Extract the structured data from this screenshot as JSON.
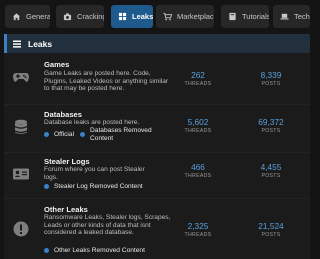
{
  "tabs": [
    {
      "label": "General",
      "icon": "home-icon"
    },
    {
      "label": "Cracking",
      "icon": "camera-icon"
    },
    {
      "label": "Leaks",
      "icon": "grid-icon",
      "active": true
    },
    {
      "label": "Marketplace",
      "icon": "cart-icon"
    },
    {
      "label": "Tutorials",
      "icon": "book-icon"
    },
    {
      "label": "Tech",
      "icon": "laptop-icon"
    }
  ],
  "section": {
    "title": "Leaks",
    "icon": "grid-icon"
  },
  "forums": [
    {
      "title": "Games",
      "icon": "gamepad-icon",
      "description": "Game Leaks are posted here. Code, Plugins, Leaked Videos or anything similar to that may be posted here.",
      "subforums": [],
      "threads": "262",
      "threads_label": "THREADS",
      "posts": "8,339",
      "posts_label": "POSTS"
    },
    {
      "title": "Databases",
      "icon": "database-icon",
      "description": "Database leaks are posted here.",
      "subforums": [
        "Official",
        "Databases Removed Content"
      ],
      "threads": "5,602",
      "threads_label": "THREADS",
      "posts": "69,372",
      "posts_label": "POSTS"
    },
    {
      "title": "Stealer Logs",
      "icon": "id-card-icon",
      "description": "Forum where you can post Stealer logs.",
      "subforums": [
        "Stealer Log Removed Content"
      ],
      "threads": "466",
      "threads_label": "THREADS",
      "posts": "4,455",
      "posts_label": "POSTS"
    },
    {
      "title": "Other Leaks",
      "icon": "alert-icon",
      "description": "Ransomware Leaks, Stealer logs, Scrapes, Leads or other kinds of data that isnt considered a leaked database.",
      "subforums": [
        "Other Leaks Removed Content"
      ],
      "threads": "2,325",
      "threads_label": "THREADS",
      "posts": "21,524",
      "posts_label": "POSTS"
    }
  ],
  "colors": {
    "accent": "#1e5a8c",
    "link": "#5aa0dd",
    "bg": "#141414"
  }
}
